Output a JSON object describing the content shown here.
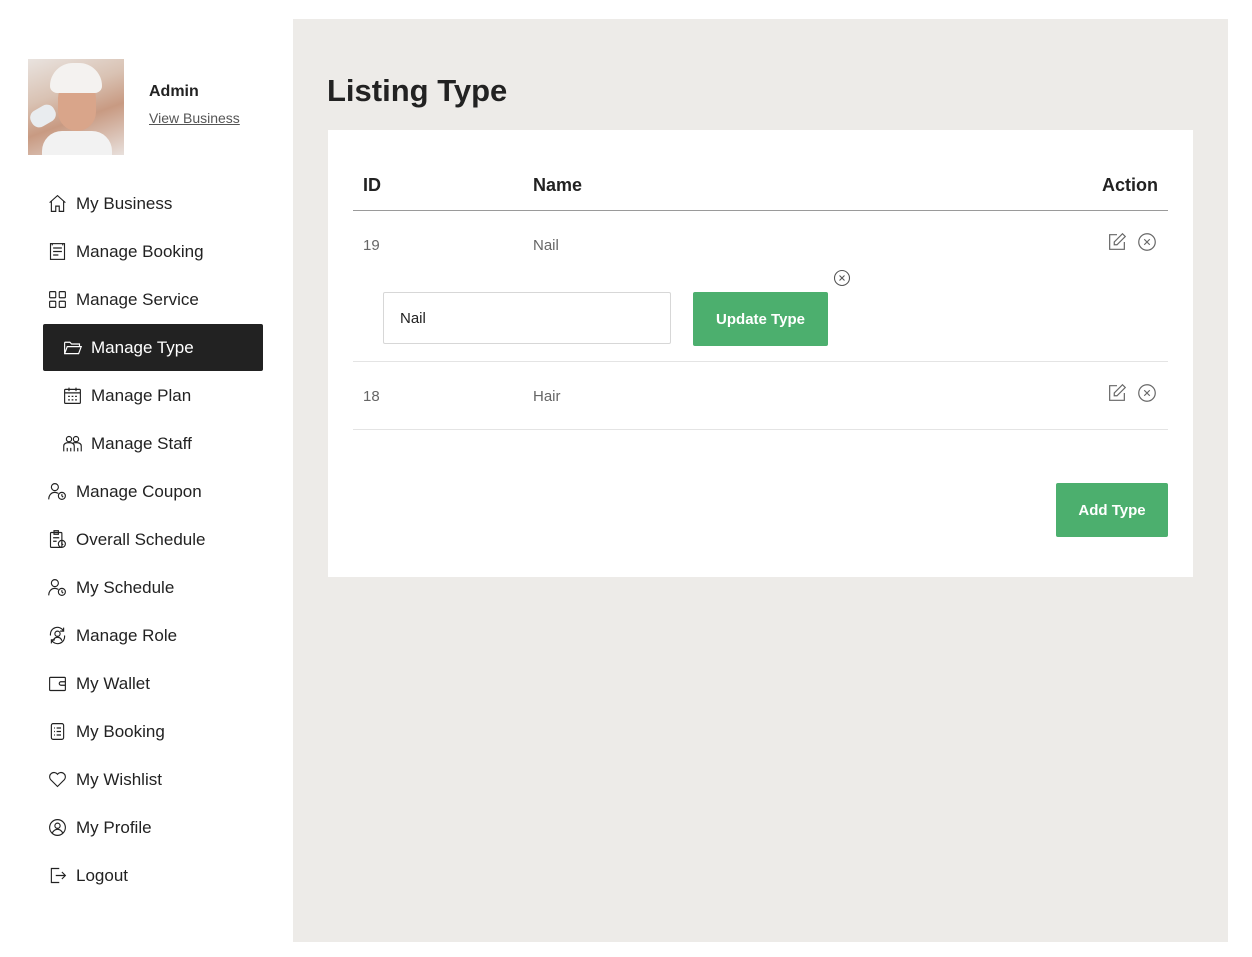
{
  "profile": {
    "name": "Admin",
    "link": "View Business"
  },
  "nav": [
    {
      "label": "My Business",
      "icon": "home-icon"
    },
    {
      "label": "Manage Booking",
      "icon": "booking-icon"
    },
    {
      "label": "Manage Service",
      "icon": "grid-icon"
    },
    {
      "label": "Manage Type",
      "icon": "folder-icon",
      "active": true
    },
    {
      "label": "Manage Plan",
      "icon": "calendar-icon"
    },
    {
      "label": "Manage Staff",
      "icon": "staff-icon"
    },
    {
      "label": "Manage Coupon",
      "icon": "user-clock-icon"
    },
    {
      "label": "Overall Schedule",
      "icon": "clipboard-clock-icon"
    },
    {
      "label": "My Schedule",
      "icon": "user-clock-icon"
    },
    {
      "label": "Manage Role",
      "icon": "user-cycle-icon"
    },
    {
      "label": "My Wallet",
      "icon": "wallet-icon"
    },
    {
      "label": "My Booking",
      "icon": "list-icon"
    },
    {
      "label": "My Wishlist",
      "icon": "heart-icon"
    },
    {
      "label": "My Profile",
      "icon": "user-circle-icon"
    },
    {
      "label": "Logout",
      "icon": "logout-icon"
    }
  ],
  "main": {
    "title": "Listing Type",
    "table": {
      "headers": {
        "id": "ID",
        "name": "Name",
        "action": "Action"
      },
      "rows": [
        {
          "id": "19",
          "name": "Nail"
        },
        {
          "id": "18",
          "name": "Hair"
        }
      ]
    },
    "edit": {
      "value": "Nail",
      "button": "Update Type"
    },
    "add_button": "Add Type"
  },
  "colors": {
    "accent": "#4caf6e",
    "active_nav": "#222222",
    "main_bg": "#edebe8"
  }
}
